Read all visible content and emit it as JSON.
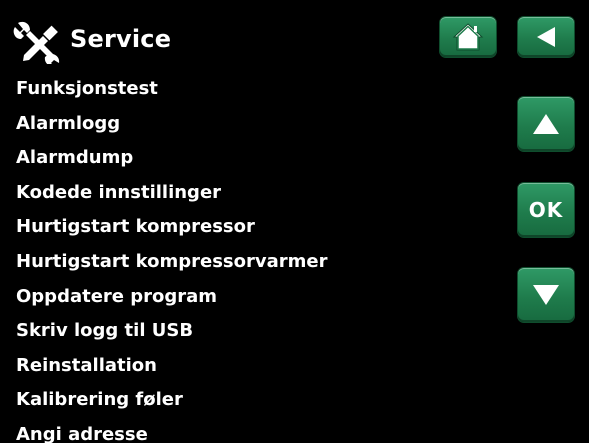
{
  "header": {
    "title": "Service",
    "title_icon": "tools-icon"
  },
  "buttons": {
    "home_icon": "home-icon",
    "back_icon": "back-arrow-icon",
    "up_icon": "up-arrow-icon",
    "ok_label": "OK",
    "down_icon": "down-arrow-icon"
  },
  "colors": {
    "background": "#000000",
    "text": "#ffffff",
    "button_green": "#1f7c4c"
  },
  "menu": {
    "items": [
      "Funksjonstest",
      "Alarmlogg",
      "Alarmdump",
      "Kodede innstillinger",
      "Hurtigstart kompressor",
      "Hurtigstart kompressorvarmer",
      "Oppdatere program",
      "Skriv logg til USB",
      "Reinstallation",
      "Kalibrering føler",
      "Angi adresse"
    ]
  }
}
